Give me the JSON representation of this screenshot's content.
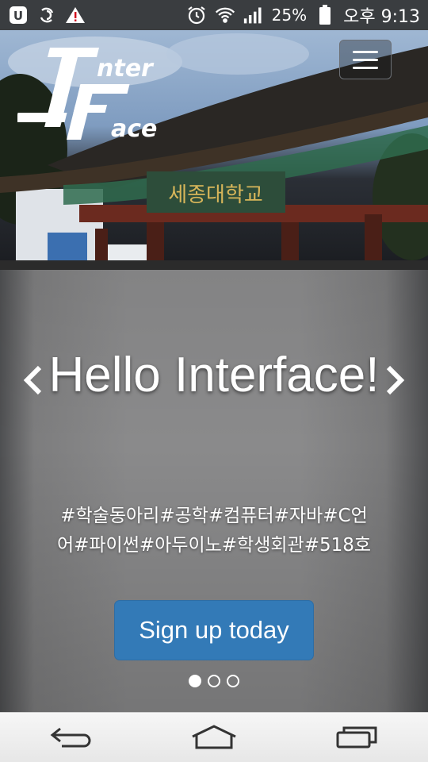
{
  "status_bar": {
    "battery_percent": "25%",
    "time": "오후 9:13",
    "icons": [
      "u-plus-icon",
      "sync-icon",
      "warning-icon",
      "alarm-icon",
      "wifi-icon",
      "signal-icon",
      "battery-icon"
    ]
  },
  "header": {
    "logo_text_top": "nter",
    "logo_text_bottom": "ace",
    "logo_initials": "IF",
    "sign_text": "세종대학교",
    "menu_icon": "hamburger-icon"
  },
  "carousel": {
    "headline": "Hello Interface!",
    "tags": "#학술동아리#공학#컴퓨터#자바#C언어#파이썬#아두이노#학생회관#518호",
    "cta_label": "Sign up today",
    "slide_count": 3,
    "active_slide": 1,
    "prev_icon": "chevron-left-icon",
    "next_icon": "chevron-right-icon",
    "accent_color": "#337ab7"
  },
  "nav_bar": {
    "icons": [
      "back-icon",
      "home-icon",
      "recent-apps-icon"
    ]
  }
}
